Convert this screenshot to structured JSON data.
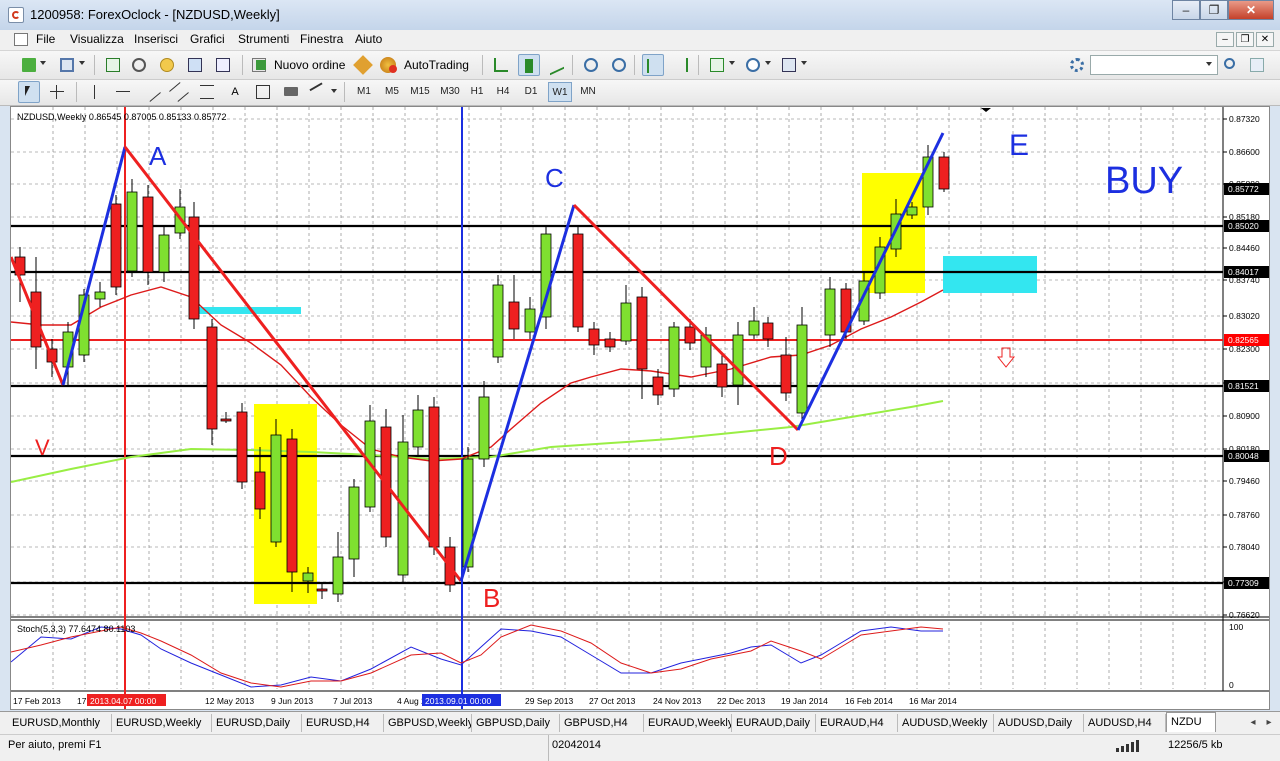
{
  "window": {
    "title": "1200958: ForexOclock - [NZDUSD,Weekly]"
  },
  "menu": [
    "File",
    "Visualizza",
    "Inserisci",
    "Grafici",
    "Strumenti",
    "Finestra",
    "Aiuto"
  ],
  "toolbar": {
    "new_order_label": "Nuovo ordine",
    "autotrading_label": "AutoTrading",
    "search_placeholder": ""
  },
  "timeframes": [
    "M1",
    "M5",
    "M15",
    "M30",
    "H1",
    "H4",
    "D1",
    "W1",
    "MN"
  ],
  "active_timeframe": "W1",
  "chart": {
    "header": "NZDUSD,Weekly  0.86545 0.87005 0.85133 0.85772",
    "symbol": "NZDUSD",
    "stoch_label": "Stoch(5,3,3) 77.6474 80.1103",
    "price_levels": [
      "0.87320",
      "0.86600",
      "0.85880",
      "0.85180",
      "0.84460",
      "0.83740",
      "0.83020",
      "0.82300",
      "0.81580",
      "0.80900",
      "0.80180",
      "0.79460",
      "0.78760",
      "0.78040",
      "0.77320",
      "0.76620"
    ],
    "marked_levels": [
      {
        "label": "0.85772",
        "color": "#000000"
      },
      {
        "label": "0.85020",
        "color": "#000000"
      },
      {
        "label": "0.84017",
        "color": "#000000"
      },
      {
        "label": "0.82565",
        "color": "#ff0000"
      },
      {
        "label": "0.81521",
        "color": "#000000"
      },
      {
        "label": "0.80048",
        "color": "#000000"
      },
      {
        "label": "0.77309",
        "color": "#000000"
      }
    ],
    "stoch_levels": [
      "100",
      "0"
    ],
    "dates": [
      "17 Feb 2013",
      "17 Mar 2013",
      "12 May 2013",
      "9 Jun 2013",
      "7 Jul 2013",
      "4 Aug 2013",
      "29 Sep 2013",
      "27 Oct 2013",
      "24 Nov 2013",
      "22 Dec 2013",
      "19 Jan 2014",
      "16 Feb 2014",
      "16 Mar 2014"
    ],
    "vline_red_label": "2013.04.07 00:00",
    "vline_blue_label": "2013.09.01 00:00",
    "annotations": {
      "A": "A",
      "B": "B",
      "C": "C",
      "D": "D",
      "E": "E",
      "V": "V",
      "BUY": "BUY"
    }
  },
  "colors": {
    "bull": "#7fe030",
    "bear": "#ee2020",
    "blue_line": "#1c2fe0",
    "red_line": "#ee2020",
    "highlight": "#ffff00",
    "cyan": "#33e6f0",
    "ma_green": "#99ee44"
  },
  "tabs": [
    "EURUSD,Monthly",
    "EURUSD,Weekly",
    "EURUSD,Daily",
    "EURUSD,H4",
    "GBPUSD,Weekly",
    "GBPUSD,Daily",
    "GBPUSD,H4",
    "EURAUD,Weekly",
    "EURAUD,Daily",
    "EURAUD,H4",
    "AUDUSD,Weekly",
    "AUDUSD,Daily",
    "AUDUSD,H4",
    "NZDU"
  ],
  "status": {
    "help": "Per aiuto, premi F1",
    "profile": "02042014",
    "traffic": "12256/5 kb"
  }
}
